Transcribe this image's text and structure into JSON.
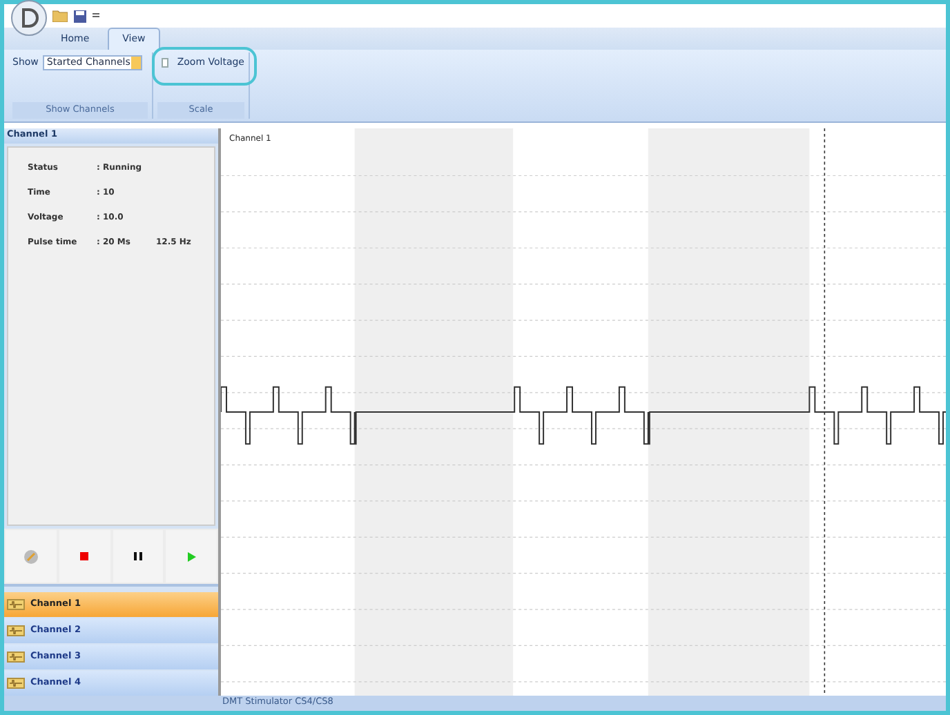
{
  "tabs": [
    {
      "label": "Home",
      "selected": false
    },
    {
      "label": "View",
      "selected": true
    }
  ],
  "ribbon": {
    "groups": [
      {
        "kind": "dropdown",
        "label": "Show",
        "value": "Started Channels",
        "caption": "Show Channels"
      },
      {
        "kind": "checkbox",
        "label": "Zoom Voltage",
        "checked": false,
        "highlighted": true,
        "caption": "Scale"
      }
    ]
  },
  "channel_panel": {
    "title": "Channel 1",
    "fields": [
      {
        "name": "Status",
        "value": ": Running"
      },
      {
        "name": "Time",
        "value": ": 10"
      },
      {
        "name": "Voltage",
        "value": ": 10.0"
      },
      {
        "name": "Pulse time",
        "value": ": 20 Ms",
        "extra": "12.5 Hz"
      }
    ]
  },
  "channels": [
    {
      "label": "Channel 1",
      "selected": true
    },
    {
      "label": "Channel 2",
      "selected": false
    },
    {
      "label": "Channel 3",
      "selected": false
    },
    {
      "label": "Channel 4",
      "selected": false
    }
  ],
  "chart": {
    "label": "Channel 1"
  },
  "status_bar": "DMT Stimulator CS4/CS8"
}
